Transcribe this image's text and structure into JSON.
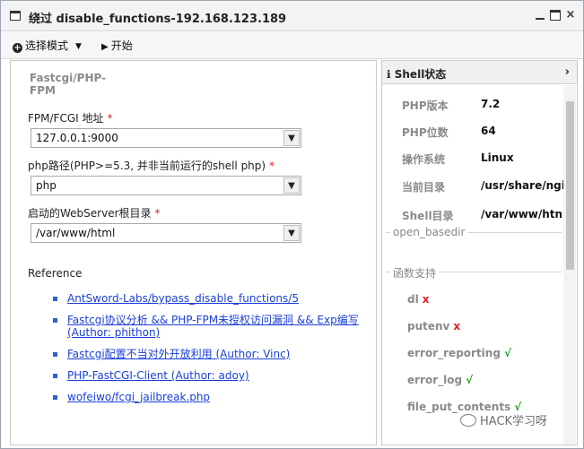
{
  "window": {
    "title": "绕过 disable_functions-192.168.123.189",
    "min_icon": "minimize-icon",
    "max_icon": "maximize-icon",
    "close_icon": "close-icon"
  },
  "toolbar": {
    "select_mode_label": "选择模式",
    "start_label": "开始"
  },
  "form": {
    "section_title": "Fastcgi/PHP-FPM",
    "fpm_label": "FPM/FCGI 地址",
    "fpm_value": "127.0.0.1:9000",
    "php_path_label": "php路径(PHP>=5.3, 并非当前运行的shell php)",
    "php_path_value": "php",
    "webroot_label": "启动的WebServer根目录",
    "webroot_value": "/var/www/html",
    "required_mark": "*"
  },
  "reference": {
    "label": "Reference",
    "links": [
      "AntSword-Labs/bypass_disable_functions/5",
      "Fastcgi协议分析 && PHP-FPM未授权访问漏洞 && Exp编写 (Author: phithon)",
      "Fastcgi配置不当对外开放利用 (Author: Vinc)",
      "PHP-FastCGI-Client (Author: adoy)",
      "wofeiwo/fcgi_jailbreak.php"
    ]
  },
  "shell_status": {
    "header": "Shell状态",
    "rows": [
      {
        "key": "PHP版本",
        "value": "7.2"
      },
      {
        "key": "PHP位数",
        "value": "64"
      },
      {
        "key": "操作系统",
        "value": "Linux"
      },
      {
        "key": "当前目录",
        "value": "/usr/share/ngi"
      },
      {
        "key": "Shell目录",
        "value": "/var/www/htn"
      }
    ],
    "open_basedir_label": "open_basedir",
    "functions_label": "函数支持",
    "functions": [
      {
        "name": "dl",
        "mark": "x"
      },
      {
        "name": "putenv",
        "mark": "x"
      },
      {
        "name": "error_reporting",
        "mark": "√"
      },
      {
        "name": "error_log",
        "mark": "√"
      },
      {
        "name": "file_put_contents",
        "mark": "√"
      }
    ]
  },
  "watermark": "HACK学习呀",
  "colors": {
    "required": "#e02020",
    "ok": "#22a020",
    "link": "#1a3fd6"
  }
}
